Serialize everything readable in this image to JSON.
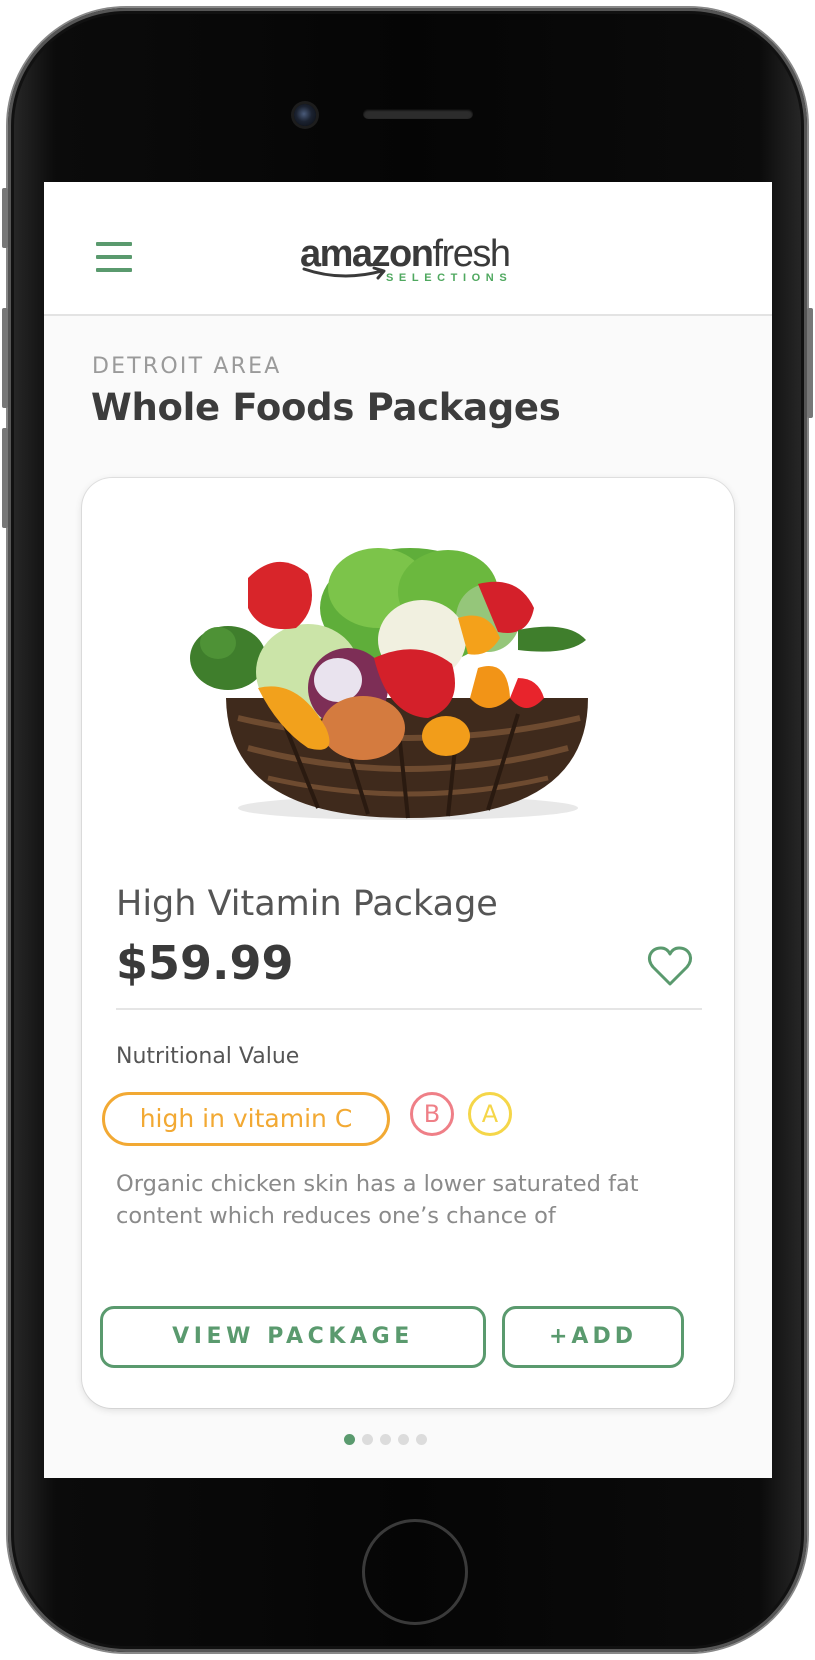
{
  "header": {
    "logo_brand": "amazon",
    "logo_suffix": "fresh",
    "logo_tagline": "SELECTIONS"
  },
  "page": {
    "area_label": "DETROIT AREA",
    "title": "Whole Foods Packages"
  },
  "product": {
    "name": "High Vitamin Package",
    "price": "$59.99",
    "nutrition_label": "Nutritional Value",
    "tag": "high in vitamin C",
    "grades": [
      "B",
      "A"
    ],
    "description": "Organic chicken skin has a lower saturated fat content which reduces one’s chance of",
    "view_button": "VIEW PACKAGE",
    "add_button": "+ADD"
  },
  "pager": {
    "total": 5,
    "active_index": 0
  },
  "colors": {
    "accent_green": "#5a9a6e",
    "tag_orange": "#f2a933",
    "grade_b": "#ef7f87",
    "grade_a": "#f5d649"
  },
  "icons": [
    "hamburger-menu-icon",
    "amazon-smile-icon",
    "heart-icon"
  ]
}
